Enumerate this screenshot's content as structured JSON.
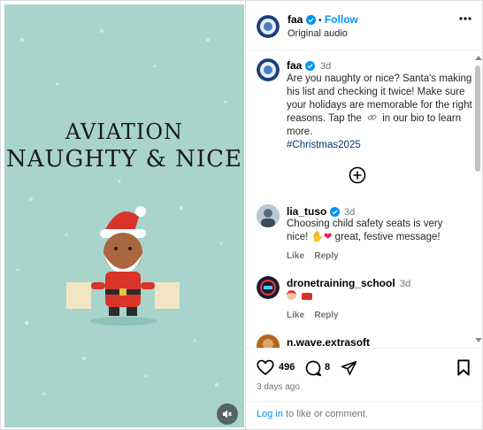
{
  "media": {
    "title_line1": "AVIATION",
    "title_line2": "NAUGHTY & NICE",
    "mute_icon": "speaker-muted-icon"
  },
  "header": {
    "username": "faa",
    "separator": "•",
    "follow_label": "Follow",
    "audio_label": "Original audio"
  },
  "caption": {
    "username": "faa",
    "time": "3d",
    "text_before_icon": "Are you naughty or nice? Santa's making his list and checking it twice! Make sure your holidays are memorable for the right reasons. Tap the",
    "text_after_icon": "in our bio to learn more.",
    "hashtag": "#Christmas2025"
  },
  "comments": [
    {
      "username": "lia_tuso",
      "time": "3d",
      "text_line1": "Choosing child safety seats is very",
      "text_line2_pre": "nice!",
      "text_line2_post": "great, festive message!",
      "like_label": "Like",
      "reply_label": "Reply"
    },
    {
      "username": "dronetraining_school",
      "time": "3d",
      "like_label": "Like",
      "reply_label": "Reply"
    },
    {
      "username": "n.wave.extrasoft"
    }
  ],
  "actions": {
    "likes": "496",
    "comments": "8",
    "posted": "3 days ago"
  },
  "footer": {
    "login_link": "Log in",
    "login_rest": "to like or comment."
  },
  "colors": {
    "accent": "#0095f6",
    "media_bg": "#a9d4cb",
    "santa_red": "#d9332a"
  }
}
